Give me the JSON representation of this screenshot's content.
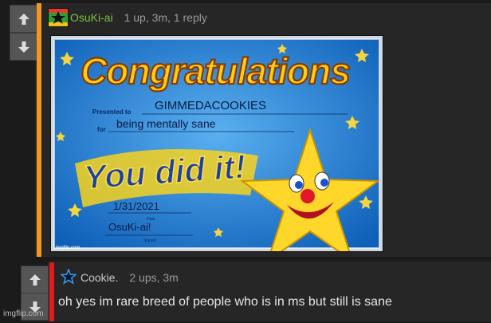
{
  "comment1": {
    "username": "OsuKi-ai",
    "meta": "1 up, 3m, 1 reply",
    "accent_color": "#f7941d"
  },
  "certificate": {
    "heading": "Congratulations",
    "presented_to_label": "Presented to",
    "recipient": "GIMMEDACOOKIES",
    "for_label": "for",
    "reason": "being mentally sane",
    "banner": "You did it!",
    "date": "1/31/2021",
    "date_label": "Date",
    "signature": "OsuKi-ai!",
    "signature_label": "Signed",
    "credit": "imgflip.com"
  },
  "comment2": {
    "username": "Cookie.",
    "meta": "2 ups, 3m",
    "text": "oh yes im rare breed of people who is in ms but still is sane",
    "accent_color": "#e21b1b"
  },
  "watermark": "imgflip.com"
}
